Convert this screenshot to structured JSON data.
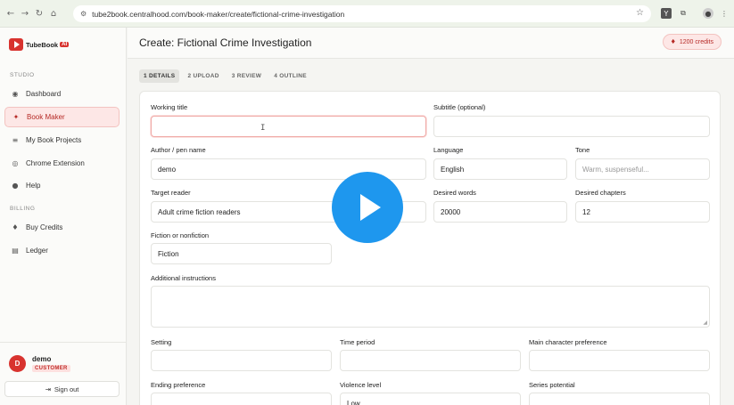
{
  "browser": {
    "url": "tube2book.centralhood.com/book-maker/create/fictional-crime-investigation"
  },
  "brand": {
    "name": "TubeBook",
    "badge": "AI",
    "color": "#d8332f"
  },
  "sidebar": {
    "studio_label": "STUDIO",
    "billing_label": "BILLING",
    "studio_items": [
      {
        "label": "Dashboard",
        "icon": "dashboard-icon"
      },
      {
        "label": "Book Maker",
        "icon": "magic-wand-icon",
        "active": true
      },
      {
        "label": "My Book Projects",
        "icon": "stack-icon"
      },
      {
        "label": "Chrome Extension",
        "icon": "chrome-icon"
      },
      {
        "label": "Help",
        "icon": "help-icon"
      }
    ],
    "billing_items": [
      {
        "label": "Buy Credits",
        "icon": "gem-icon"
      },
      {
        "label": "Ledger",
        "icon": "ledger-icon"
      }
    ],
    "user": {
      "initial": "D",
      "name": "demo",
      "role": "CUSTOMER"
    },
    "signout_label": "Sign out"
  },
  "header": {
    "title": "Create: Fictional Crime Investigation",
    "credits": "1200 credits"
  },
  "steps": [
    "1 DETAILS",
    "2 UPLOAD",
    "3 REVIEW",
    "4 OUTLINE"
  ],
  "form": {
    "working_title": {
      "label": "Working title",
      "value": ""
    },
    "subtitle": {
      "label": "Subtitle (optional)",
      "value": ""
    },
    "author": {
      "label": "Author / pen name",
      "value": "demo"
    },
    "language": {
      "label": "Language",
      "value": "English"
    },
    "tone": {
      "label": "Tone",
      "placeholder": "Warm, suspenseful..."
    },
    "target_reader": {
      "label": "Target reader",
      "value": "Adult crime fiction readers"
    },
    "desired_words": {
      "label": "Desired words",
      "value": "20000"
    },
    "desired_chapters": {
      "label": "Desired chapters",
      "value": "12"
    },
    "fiction": {
      "label": "Fiction or nonfiction",
      "value": "Fiction"
    },
    "instructions": {
      "label": "Additional instructions",
      "value": ""
    },
    "setting": {
      "label": "Setting",
      "value": ""
    },
    "time_period": {
      "label": "Time period",
      "value": ""
    },
    "main_character": {
      "label": "Main character preference",
      "value": ""
    },
    "ending": {
      "label": "Ending preference",
      "value": ""
    },
    "violence": {
      "label": "Violence level",
      "value": "Low"
    },
    "series": {
      "label": "Series potential",
      "value": ""
    }
  },
  "colors": {
    "accent": "#d8332f",
    "play": "#1e97ee"
  }
}
